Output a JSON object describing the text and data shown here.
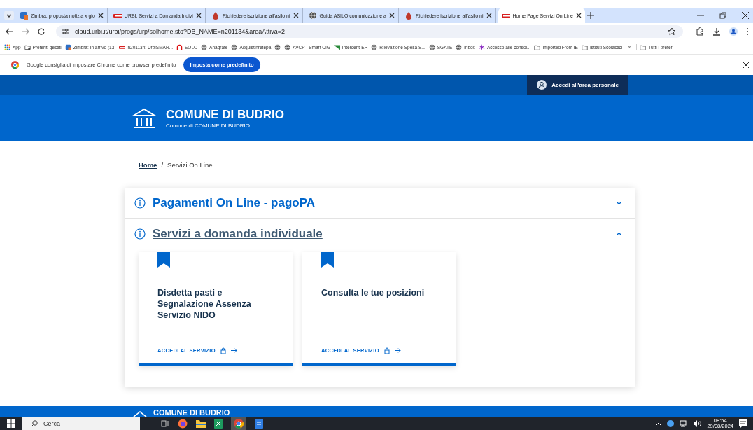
{
  "browser": {
    "tabs": [
      {
        "title": "Zimbra: proposta notizia x gio",
        "kind": "zimbra",
        "selected": false
      },
      {
        "title": "URBI: Servizi a Domanda Indivi",
        "kind": "urbi",
        "selected": false
      },
      {
        "title": "Richiedere iscrizione all'asilo ni",
        "kind": "drop",
        "selected": false
      },
      {
        "title": "Guida ASILO comunicazione a",
        "kind": "globe",
        "selected": false
      },
      {
        "title": "Richiedere iscrizione all'asilo ni",
        "kind": "drop",
        "selected": false
      },
      {
        "title": "Home Page Servizi On Line",
        "kind": "urbi",
        "selected": true
      }
    ],
    "address": "cloud.urbi.it/urbi/progs/urp/solhome.sto?DB_NAME=n201134&areaAttiva=2",
    "bookmarks": [
      {
        "label": "App",
        "kind": "apps"
      },
      {
        "label": "Preferiti gestiti",
        "kind": "managed"
      },
      {
        "label": "Zimbra: In arrivo (13)",
        "kind": "zimbra"
      },
      {
        "label": "n201134: UrbiSMAR...",
        "kind": "urbi"
      },
      {
        "label": "EOLO",
        "kind": "eolo"
      },
      {
        "label": "Anagrafe",
        "kind": "globe"
      },
      {
        "label": "Acquistinretepa",
        "kind": "globe"
      },
      {
        "kind": "globe"
      },
      {
        "label": "AVCP - Smart CIG",
        "kind": "globe"
      },
      {
        "label": "Intercent-ER",
        "kind": "flag"
      },
      {
        "label": "Rilevazione Spesa S...",
        "kind": "globe"
      },
      {
        "label": "SGATE",
        "kind": "globe"
      },
      {
        "label": "inbox",
        "kind": "globe"
      },
      {
        "label": "Accesso alle consol...",
        "kind": "star"
      },
      {
        "label": "Imported From IE",
        "kind": "folder"
      },
      {
        "label": "Istituti Scolastici",
        "kind": "folder"
      }
    ],
    "more": "»",
    "all_bookmarks": "Tutti i preferi",
    "notice": {
      "text": "Google consiglia di impostare Chrome come browser predefinito",
      "button": "Imposta come predefinito"
    }
  },
  "site": {
    "login_button": "Accedi all'area personale",
    "title": "COMUNE DI BUDRIO",
    "subtitle": "Comune di COMUNE DI BUDRIO",
    "breadcrumb": [
      {
        "label": "Home",
        "link": true
      },
      {
        "label": "Servizi On Line",
        "link": false
      }
    ],
    "breadcrumb_separator": "/",
    "sections": [
      {
        "title": "Pagamenti On Line - pagoPA",
        "expanded": false
      },
      {
        "title": "Servizi a domanda individuale",
        "expanded": true,
        "cards": [
          {
            "title": "Disdetta pasti e Segnalazione Assenza Servizio NIDO",
            "link": "ACCEDI AL SERVIZIO"
          },
          {
            "title": "Consulta le tue posizioni",
            "link": "ACCEDI AL SERVIZIO"
          }
        ]
      }
    ],
    "footer_title": "COMUNE DI BUDRIO"
  },
  "taskbar": {
    "search": "Cerca",
    "time": "08:54",
    "date": "29/08/2024"
  }
}
